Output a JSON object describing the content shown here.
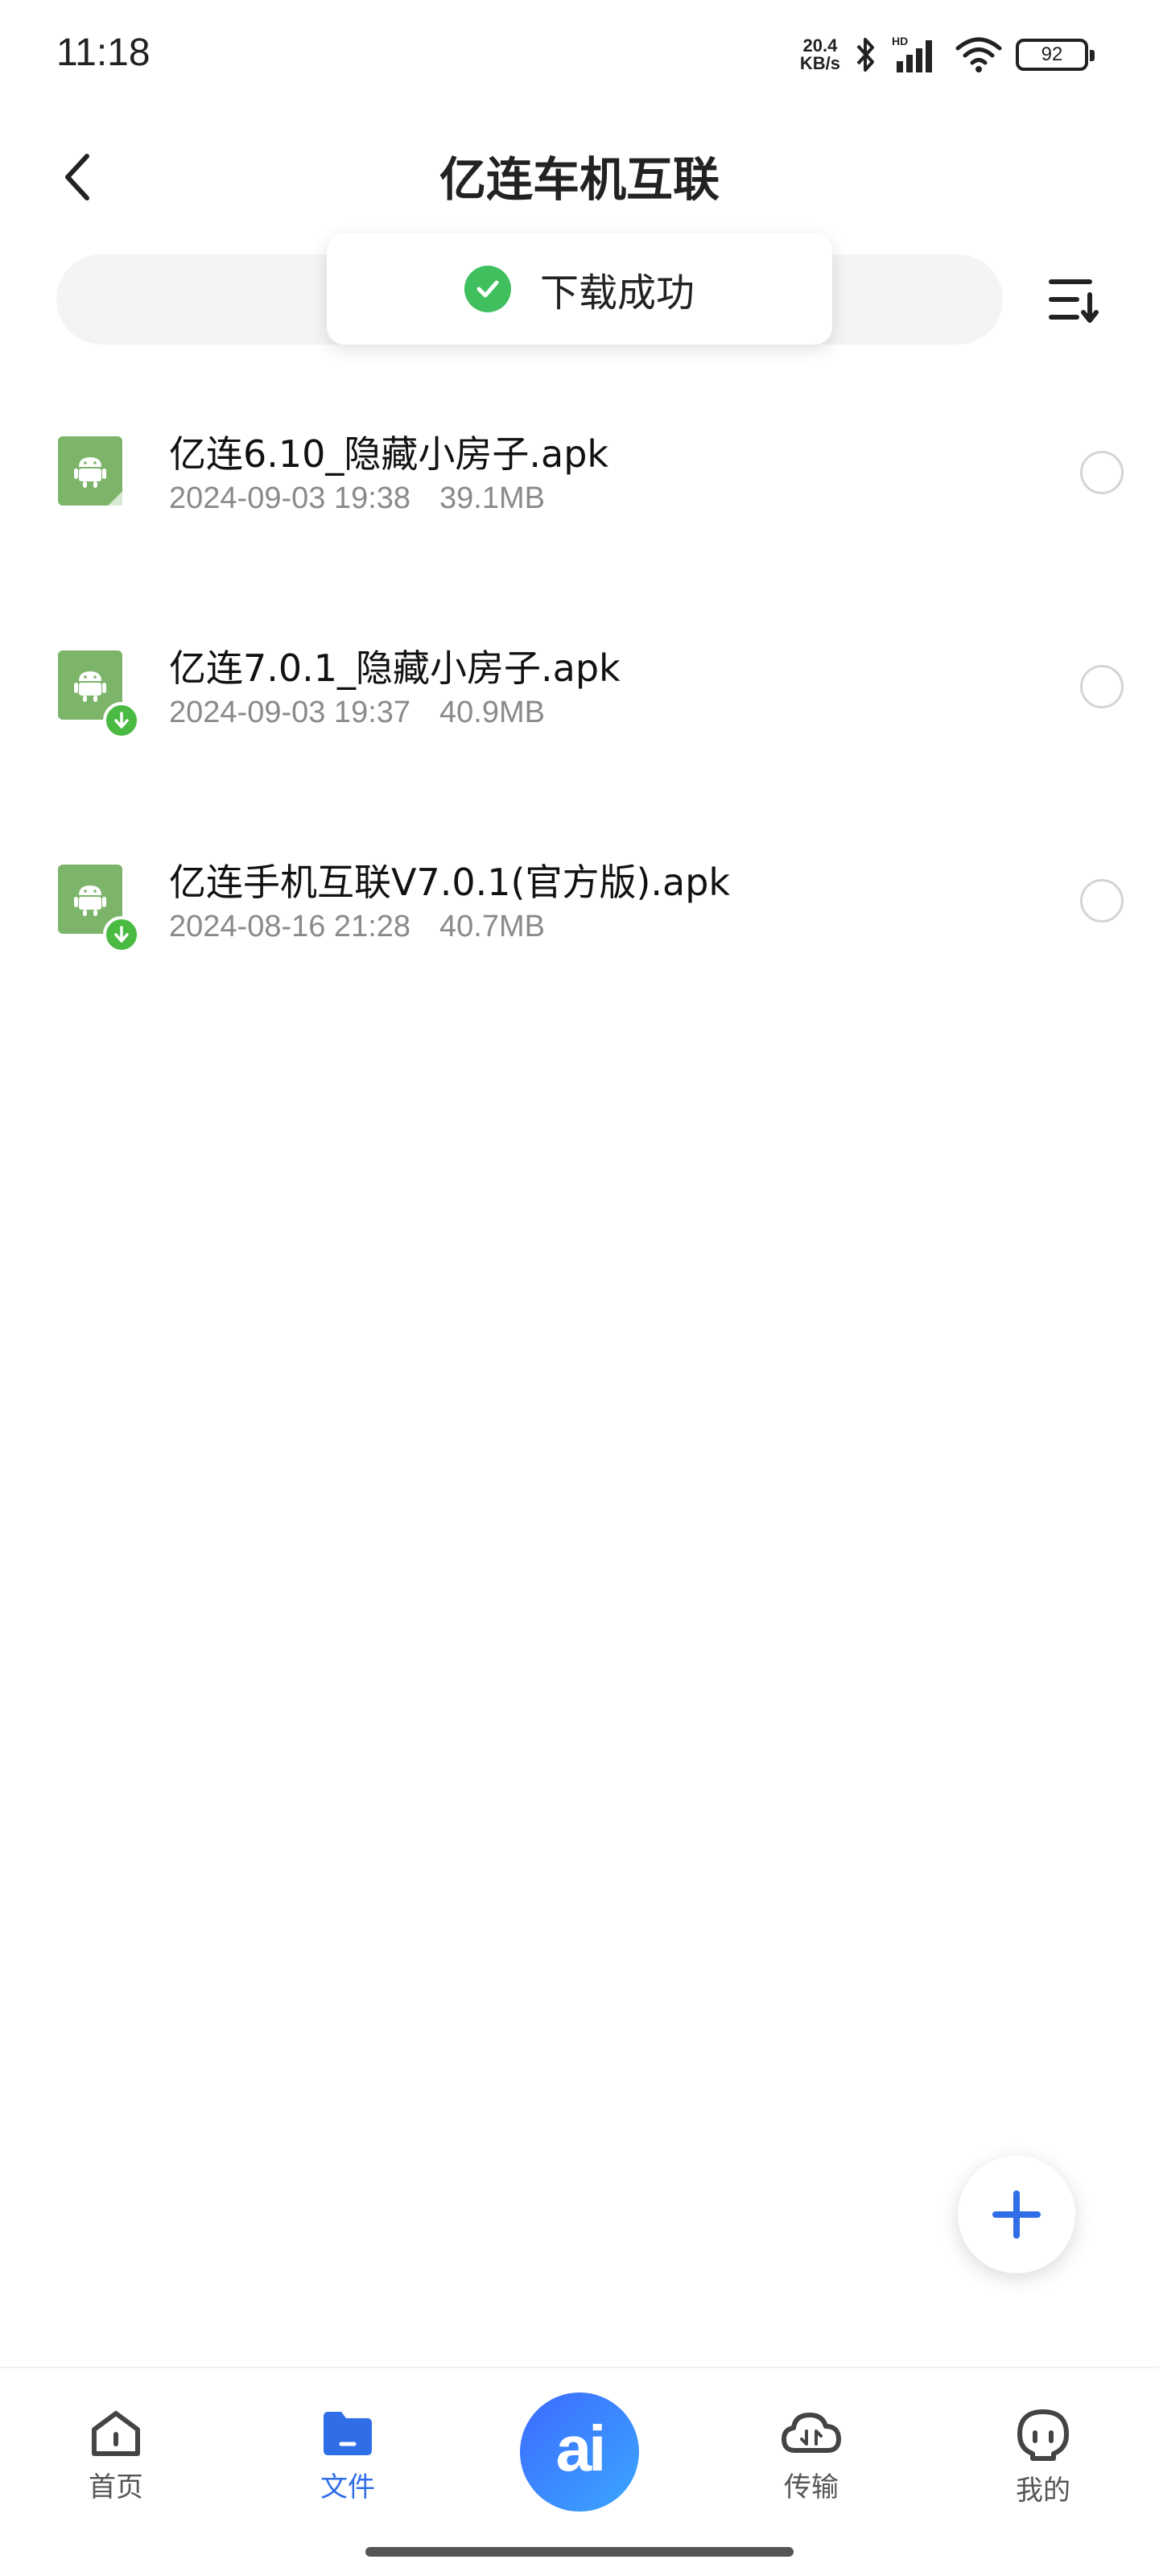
{
  "status_bar": {
    "time": "11:18",
    "net_speed_value": "20.4",
    "net_speed_unit": "KB/s",
    "battery": "92",
    "icons": [
      "bluetooth-icon",
      "hd-signal-icon",
      "wifi-icon",
      "battery-icon"
    ]
  },
  "header": {
    "title": "亿连车机互联",
    "back_icon": "chevron-left-icon",
    "sort_icon": "sort-icon"
  },
  "toast": {
    "text": "下载成功",
    "icon": "check-circle-icon",
    "color": "#3fbf5d"
  },
  "files": [
    {
      "name": "亿连6.10_隐藏小房子.apk",
      "date": "2024-09-03 19:38",
      "size": "39.1MB",
      "downloaded": false
    },
    {
      "name": "亿连7.0.1_隐藏小房子.apk",
      "date": "2024-09-03 19:37",
      "size": "40.9MB",
      "downloaded": true
    },
    {
      "name": "亿连手机互联V7.0.1(官方版).apk",
      "date": "2024-08-16 21:28",
      "size": "40.7MB",
      "downloaded": true
    }
  ],
  "fab": {
    "icon": "plus-icon",
    "color": "#2f6ee6"
  },
  "bottom_nav": {
    "items": [
      {
        "label": "首页",
        "icon": "home-icon",
        "active": false
      },
      {
        "label": "文件",
        "icon": "folder-icon",
        "active": true
      },
      {
        "label": "ai",
        "icon": "ai-icon",
        "active": false
      },
      {
        "label": "传输",
        "icon": "cloud-transfer-icon",
        "active": false
      },
      {
        "label": "我的",
        "icon": "profile-icon",
        "active": false
      }
    ]
  },
  "colors": {
    "accent": "#2f6ee6",
    "apk_icon": "#7cb46a",
    "download_badge": "#4aba42"
  }
}
